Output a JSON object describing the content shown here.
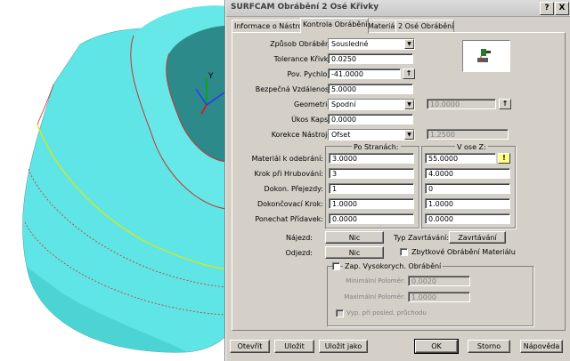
{
  "window": {
    "title": "SURFCAM Obrábění 2 Osé Křivky",
    "help_button": "?",
    "close_button": "X"
  },
  "tabs": [
    "Informace o Nástroji",
    "Kontrola Obrábění",
    "Materiál",
    "2 Osé Obrábění"
  ],
  "active_tab": 1,
  "form": {
    "zpusob_label": "Způsob Obrábění:",
    "zpusob_value": "Sousledné",
    "tolerance_label": "Tolerance Křivky:",
    "tolerance_value": "0.0250",
    "pov_pychlop_label": "Pov. Pychlop:",
    "pov_pychlop_value": "-41.0000",
    "bezpecna_label": "Bezpečná Vzdálenost:",
    "bezpecna_value": "5.0000",
    "geometrie_label": "Geometrie:",
    "geometrie_value": "Spodní",
    "geometrie_aux": "10.0000",
    "ukos_label": "Úkos Kapsy:",
    "ukos_value": "0.0000",
    "korekce_label": "Korekce Nástroje:",
    "korekce_value": "Ofset",
    "korekce_aux": "1.2500"
  },
  "columns": {
    "po_stranach": "Po Stranách:",
    "v_ose_z": "V ose Z:"
  },
  "material_rows": [
    {
      "label": "Materiál k odebrání:",
      "stranach": "3.0000",
      "osez": "55.0000"
    },
    {
      "label": "Krok při Hrubování:",
      "stranach": "3",
      "osez": "4.0000"
    },
    {
      "label": "Dokon. Přejezdy:",
      "stranach": "1",
      "osez": "0"
    },
    {
      "label": "Dokončovací Krok:",
      "stranach": "1.0000",
      "osez": "1.0000"
    },
    {
      "label": "Ponechat Přídavek:",
      "stranach": "0.0000",
      "osez": "0.0000"
    }
  ],
  "najezd": {
    "label": "Nájezd:",
    "button": "Nic"
  },
  "odjezd": {
    "label": "Odjezd:",
    "button": "Nic"
  },
  "typ_zavrtavani": {
    "label": "Typ Zavrtávání:",
    "button": "Zavrtávání"
  },
  "zbytkove_label": "Zbytkové Obrábění Materiálu",
  "vysokorych": {
    "label": "Zap. Vysokorych. Obrábění",
    "min_label": "Minimální Poloměr:",
    "min_value": "0.0020",
    "max_label": "Maximální Poloměr:",
    "max_value": "1.0000",
    "vyp_label": "Vyp. při posled. průchodu"
  },
  "buttons": {
    "otevrit": "Otevřít",
    "ulozit": "Uložit",
    "ulozit_jako": "Uložit jako",
    "ok": "OK",
    "storno": "Storno",
    "napoveda": "Nápověda"
  },
  "colors": {
    "dialog_bg": "#d4d0c8",
    "model_face": "#4fe3e3",
    "model_shadow": "#2f8f8f",
    "edge_red": "#c83232",
    "edge_yellow": "#e6e600"
  },
  "viewport": {
    "axis_y": "Y",
    "axis_x": "X"
  }
}
